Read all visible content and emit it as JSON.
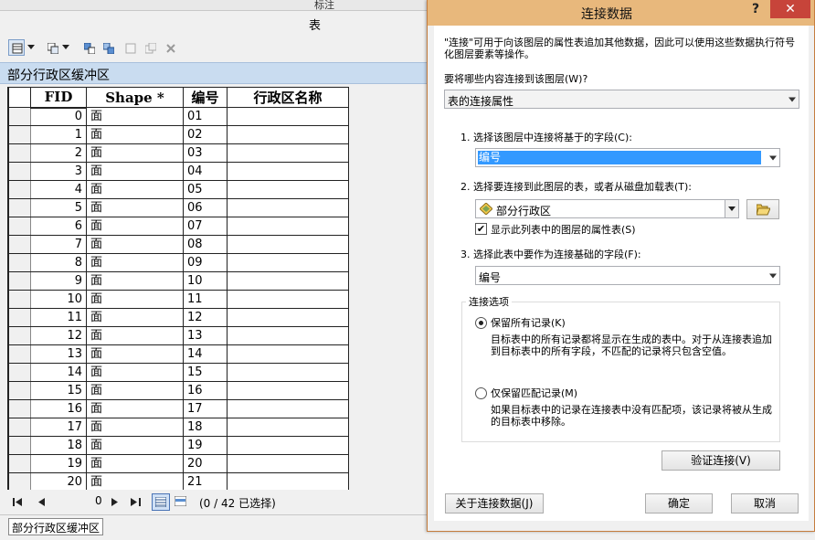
{
  "table_window": {
    "title": "表",
    "topbar_text": "标注",
    "layer_name": "部分行政区缓冲区",
    "columns": [
      "FID",
      "Shape *",
      "编号",
      "行政区名称"
    ],
    "rows": [
      {
        "fid": "0",
        "shape": "面",
        "code": "01",
        "name": ""
      },
      {
        "fid": "1",
        "shape": "面",
        "code": "02",
        "name": ""
      },
      {
        "fid": "2",
        "shape": "面",
        "code": "03",
        "name": ""
      },
      {
        "fid": "3",
        "shape": "面",
        "code": "04",
        "name": ""
      },
      {
        "fid": "4",
        "shape": "面",
        "code": "05",
        "name": ""
      },
      {
        "fid": "5",
        "shape": "面",
        "code": "06",
        "name": ""
      },
      {
        "fid": "6",
        "shape": "面",
        "code": "07",
        "name": ""
      },
      {
        "fid": "7",
        "shape": "面",
        "code": "08",
        "name": ""
      },
      {
        "fid": "8",
        "shape": "面",
        "code": "09",
        "name": ""
      },
      {
        "fid": "9",
        "shape": "面",
        "code": "10",
        "name": ""
      },
      {
        "fid": "10",
        "shape": "面",
        "code": "11",
        "name": ""
      },
      {
        "fid": "11",
        "shape": "面",
        "code": "12",
        "name": ""
      },
      {
        "fid": "12",
        "shape": "面",
        "code": "13",
        "name": ""
      },
      {
        "fid": "13",
        "shape": "面",
        "code": "14",
        "name": ""
      },
      {
        "fid": "14",
        "shape": "面",
        "code": "15",
        "name": ""
      },
      {
        "fid": "15",
        "shape": "面",
        "code": "16",
        "name": ""
      },
      {
        "fid": "16",
        "shape": "面",
        "code": "17",
        "name": ""
      },
      {
        "fid": "17",
        "shape": "面",
        "code": "18",
        "name": ""
      },
      {
        "fid": "18",
        "shape": "面",
        "code": "19",
        "name": ""
      },
      {
        "fid": "19",
        "shape": "面",
        "code": "20",
        "name": ""
      },
      {
        "fid": "20",
        "shape": "面",
        "code": "21",
        "name": ""
      }
    ],
    "nav": {
      "current": "0",
      "status": "(0 / 42 已选择)"
    },
    "tab_label": "部分行政区缓冲区"
  },
  "dialog": {
    "title": "连接数据",
    "help": "?",
    "close": "✕",
    "intro": "\"连接\"可用于向该图层的属性表追加其他数据，因此可以使用这些数据执行符号化图层要素等操作。",
    "join_what_label": "要将哪些内容连接到该图层(W)?",
    "join_what_value": "表的连接属性",
    "step1_label": "1. 选择该图层中连接将基于的字段(C):",
    "step1_value": "编号",
    "step2_label": "2. 选择要连接到此图层的表，或者从磁盘加载表(T):",
    "step2_value": "部分行政区",
    "show_layers_label": "显示此列表中的图层的属性表(S)",
    "show_layers_checked": true,
    "step3_label": "3. 选择此表中要作为连接基础的字段(F):",
    "step3_value": "编号",
    "options_title": "连接选项",
    "keep_all_label": "保留所有记录(K)",
    "keep_all_desc": "目标表中的所有记录都将显示在生成的表中。对于从连接表追加到目标表中的所有字段，不匹配的记录将只包含空值。",
    "keep_match_label": "仅保留匹配记录(M)",
    "keep_match_desc": "如果目标表中的记录在连接表中没有匹配项，该记录将被从生成的目标表中移除。",
    "validate_label": "验证连接(V)",
    "about_label": "关于连接数据(J)",
    "ok_label": "确定",
    "cancel_label": "取消"
  },
  "colors": {
    "dialog_title_bg": "#e8b87c",
    "close_bg": "#c7443a",
    "selection_bg": "#3399ff",
    "layer_bar_bg": "#c9dcf0"
  }
}
